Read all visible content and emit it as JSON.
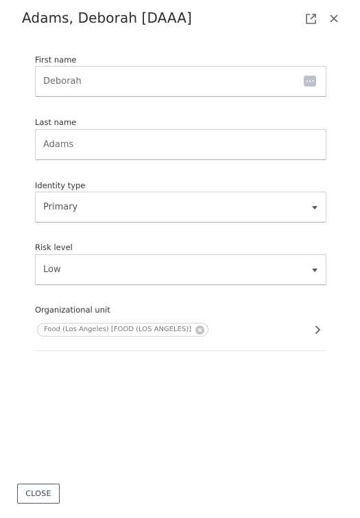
{
  "header": {
    "title": "Adams, Deborah [DAAA]",
    "open_icon": "open-in-new-icon",
    "close_icon": "close-icon"
  },
  "fields": {
    "first_name": {
      "label": "First name",
      "value": "Deborah",
      "icon": "more-dots-icon"
    },
    "last_name": {
      "label": "Last name",
      "value": "Adams"
    },
    "identity_type": {
      "label": "Identity type",
      "value": "Primary"
    },
    "risk_level": {
      "label": "Risk level",
      "value": "Low"
    },
    "org_unit": {
      "label": "Organizational unit",
      "chip": "Food (Los Angeles) [FOOD (LOS ANGELES)]"
    }
  },
  "footer": {
    "close_label": "CLOSE"
  },
  "colors": {
    "border": "#cfcfcf",
    "button_border": "#4b5b6e",
    "text": "#2a2a2a"
  }
}
